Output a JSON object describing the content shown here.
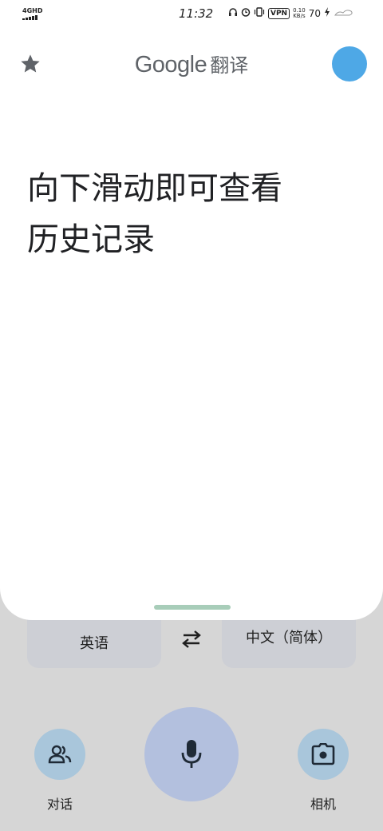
{
  "status_bar": {
    "network": "4GHD",
    "time": "11:32",
    "vpn": "VPN",
    "speed_value": "0.10",
    "speed_unit": "KB/s",
    "battery": "70"
  },
  "header": {
    "brand": "Google",
    "title": "翻译",
    "star_icon": "star-icon",
    "avatar_color": "#4ea8e6"
  },
  "main": {
    "hint_line1": "向下滑动即可查看",
    "hint_line2": "历史记录"
  },
  "languages": {
    "source": "英语",
    "target": "中文（简体）",
    "swap_icon": "swap-arrows-icon"
  },
  "actions": {
    "conversation_label": "对话",
    "camera_label": "相机",
    "mic_icon": "microphone-icon",
    "conversation_icon": "people-icon",
    "camera_icon": "camera-icon"
  }
}
